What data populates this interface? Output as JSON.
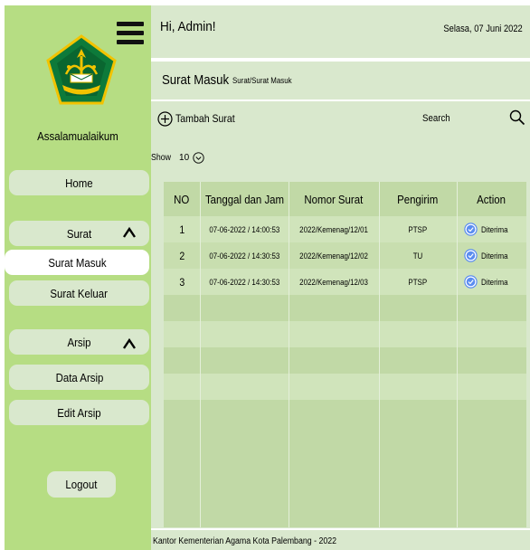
{
  "sidebar": {
    "greeting": "Assalamualaikum",
    "home_label": "Home",
    "surat_label": "Surat",
    "surat_masuk_label": "Surat Masuk",
    "surat_keluar_label": "Surat Keluar",
    "arsip_label": "Arsip",
    "data_arsip_label": "Data Arsip",
    "edit_arsip_label": "Edit Arsip",
    "logout_label": "Logout",
    "logo_icon": "kemenag-logo",
    "menu_icon": "hamburger-menu-icon"
  },
  "header": {
    "greeting": "Hi, Admin!",
    "date": "Selasa, 07 Juni 2022"
  },
  "page": {
    "title": "Surat Masuk",
    "breadcrumb": "Surat/Surat Masuk"
  },
  "toolbar": {
    "add_label": "Tambah Surat",
    "search_label": "Search :",
    "search_value": "",
    "show_label": "Show",
    "show_value": "10"
  },
  "table": {
    "columns": [
      "NO",
      "Tanggal dan Jam",
      "Nomor Surat",
      "Pengirim",
      "Action"
    ],
    "rows": [
      {
        "no": "1",
        "tanggal": "07-06-2022 / 14:00:53",
        "nomor": "2022/Kemenag/12/01",
        "pengirim": "PTSP",
        "action": "Diterima"
      },
      {
        "no": "2",
        "tanggal": "07-06-2022 / 14:30:53",
        "nomor": "2022/Kemenag/12/02",
        "pengirim": "TU",
        "action": "Diterima"
      },
      {
        "no": "3",
        "tanggal": "07-06-2022 / 14:30:53",
        "nomor": "2022/Kemenag/12/03",
        "pengirim": "PTSP",
        "action": "Diterima"
      }
    ]
  },
  "footer": {
    "text": "Kantor Kementerian Agama Kota Palembang - 2022"
  },
  "colors": {
    "sidebar": "#b6dd83",
    "panel": "#d9e8cd",
    "table": "#c1d9a6",
    "check": "#5b8df0"
  }
}
